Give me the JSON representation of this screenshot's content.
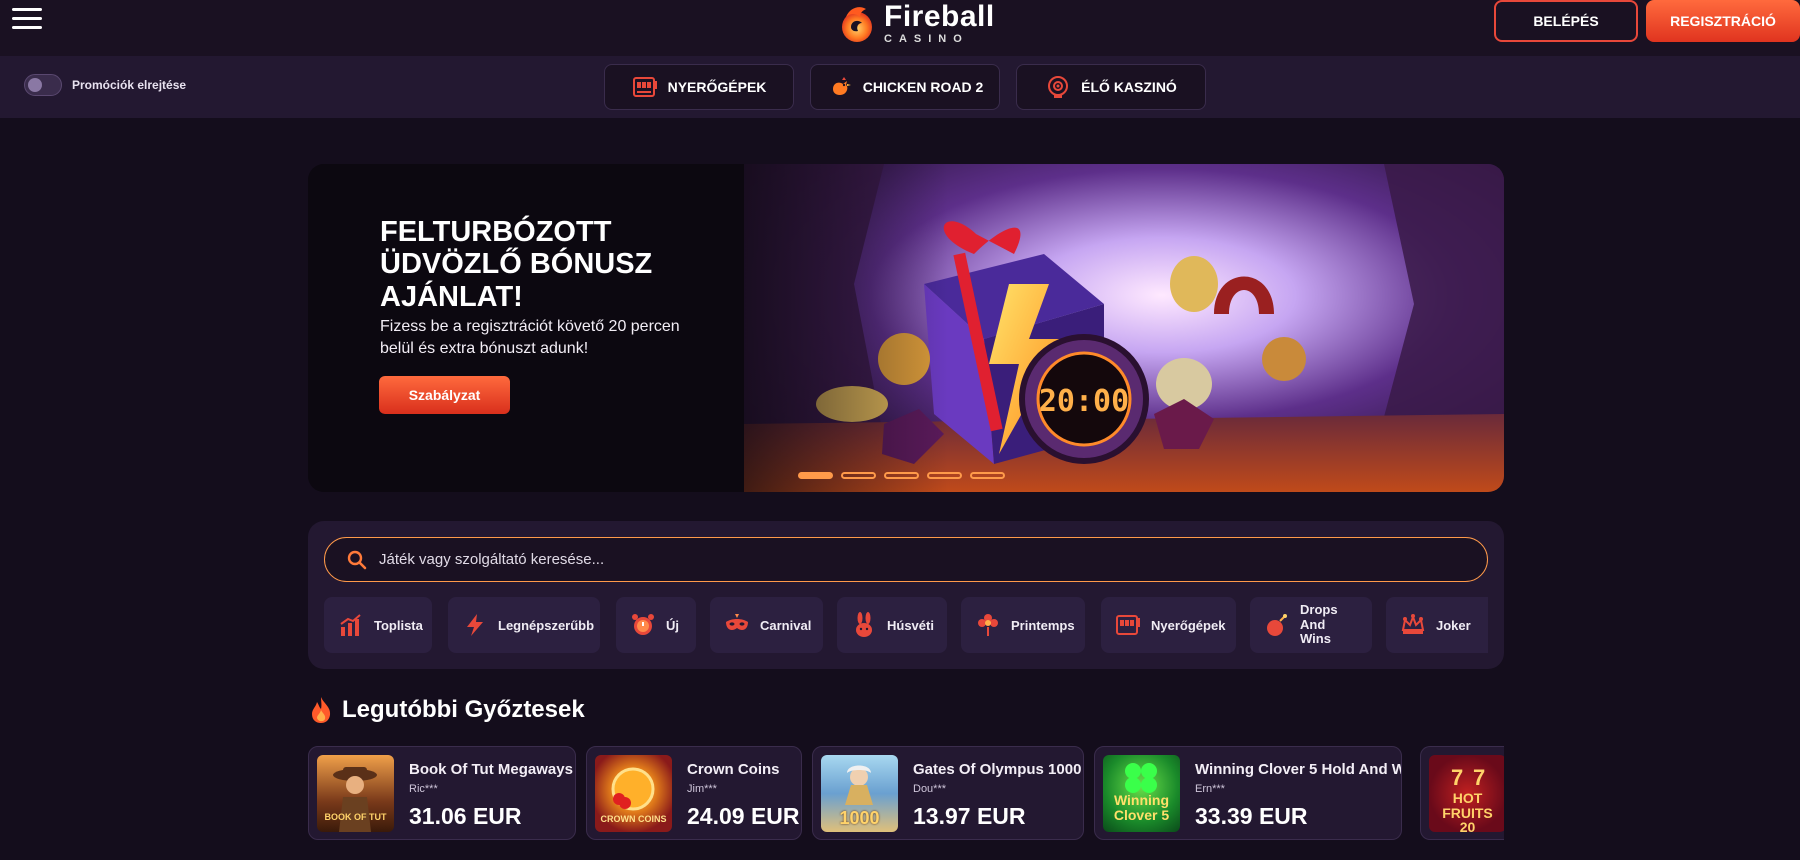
{
  "header": {
    "menu_icon": "hamburger-icon",
    "logo": {
      "name": "Fireball",
      "sub": "CASINO",
      "icon": "fireball-icon"
    },
    "login_label": "BELÉPÉS",
    "register_label": "REGISZTRÁCIÓ"
  },
  "navbar": {
    "promo_toggle_label": "Promóciók elrejtése",
    "promo_toggle_on": false,
    "tabs": [
      {
        "label": "NYERŐGÉPEK",
        "icon": "slot-machine-icon"
      },
      {
        "label": "CHICKEN ROAD 2",
        "icon": "chicken-icon"
      },
      {
        "label": "ÉLŐ KASZINÓ",
        "icon": "roulette-icon"
      }
    ]
  },
  "banner": {
    "title": "FELTURBÓZOTT ÜDVÖZLŐ BÓNUSZ AJÁNLAT!",
    "subtitle": "Fizess be a regisztrációt követő 20 percen belül és extra bónuszt adunk!",
    "button_label": "Szabályzat",
    "timer_text": "20:00",
    "slide_count": 5,
    "active_slide": 1
  },
  "search": {
    "placeholder": "Játék vagy szolgáltató keresése..."
  },
  "categories": [
    {
      "label": "Toplista",
      "icon": "bar-chart-icon"
    },
    {
      "label": "Legnépszerűbb",
      "icon": "lightning-icon"
    },
    {
      "label": "Új",
      "icon": "alarm-clock-icon"
    },
    {
      "label": "Carnival",
      "icon": "carnival-mask-icon"
    },
    {
      "label": "Húsvéti",
      "icon": "easter-bunny-icon"
    },
    {
      "label": "Printemps",
      "icon": "flower-icon"
    },
    {
      "label": "Nyerőgépek",
      "icon": "slot-machine-icon"
    },
    {
      "label": "Drops And Wins",
      "icon": "bomb-icon"
    },
    {
      "label": "Joker",
      "icon": "joker-crown-icon"
    }
  ],
  "winners": {
    "title": "Legutóbbi Győztesek",
    "icon": "flame-icon",
    "items": [
      {
        "game": "Book Of Tut Megaways",
        "user": "Ric***",
        "amount": "31.06 EUR",
        "thumb_text": "BOOK OF TUT"
      },
      {
        "game": "Crown Coins",
        "user": "Jim***",
        "amount": "24.09 EUR",
        "thumb_text": "CROWN COINS"
      },
      {
        "game": "Gates Of Olympus 1000",
        "user": "Dou***",
        "amount": "13.97 EUR",
        "thumb_text": "1000"
      },
      {
        "game": "Winning Clover 5 Hold And W...",
        "user": "Ern***",
        "amount": "33.39 EUR",
        "thumb_text": "Winning Clover 5"
      },
      {
        "game": "",
        "user": "",
        "amount": "",
        "thumb_text": "HOT FRUITS 20"
      }
    ]
  },
  "colors": {
    "background": "#140d1c",
    "panel": "#231831",
    "accent_orange": "#ff9a4a",
    "accent_red": "#e8483a"
  }
}
